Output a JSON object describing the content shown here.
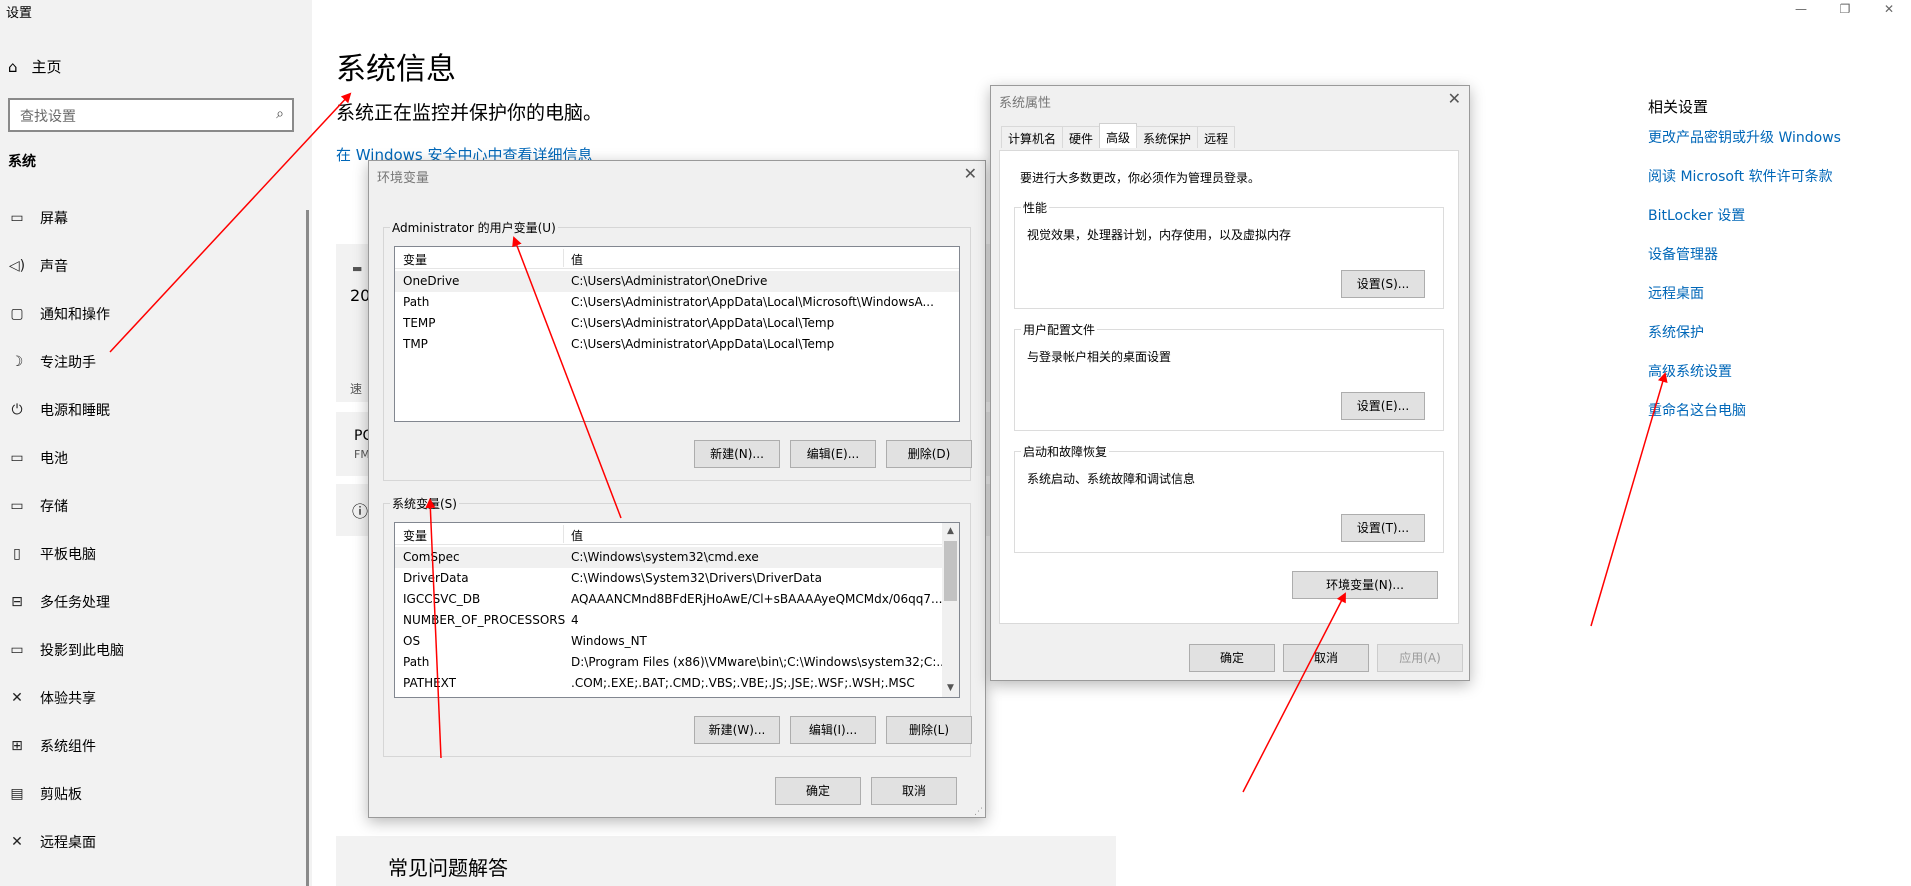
{
  "settings": {
    "window_title": "设置",
    "home_label": "主页",
    "search_placeholder": "查找设置",
    "section_label": "系统",
    "nav_items": [
      {
        "label": "屏幕",
        "icon": "display-icon"
      },
      {
        "label": "声音",
        "icon": "speaker-icon"
      },
      {
        "label": "通知和操作",
        "icon": "notification-icon"
      },
      {
        "label": "专注助手",
        "icon": "moon-icon"
      },
      {
        "label": "电源和睡眠",
        "icon": "power-icon"
      },
      {
        "label": "电池",
        "icon": "battery-icon"
      },
      {
        "label": "存储",
        "icon": "storage-icon"
      },
      {
        "label": "平板电脑",
        "icon": "tablet-icon"
      },
      {
        "label": "多任务处理",
        "icon": "multitask-icon"
      },
      {
        "label": "投影到此电脑",
        "icon": "project-icon"
      },
      {
        "label": "体验共享",
        "icon": "share-icon"
      },
      {
        "label": "系统组件",
        "icon": "components-icon"
      },
      {
        "label": "剪贴板",
        "icon": "clipboard-icon"
      },
      {
        "label": "远程桌面",
        "icon": "remote-icon"
      }
    ]
  },
  "main": {
    "title": "系统信息",
    "subtitle": "系统正在监控并保护你的电脑。",
    "security_link": "在 Windows 安全中心中查看详细信息",
    "card_fragments": [
      "20",
      "速",
      "PC",
      "FM"
    ],
    "faq_heading": "常见问题解答"
  },
  "related": {
    "title": "相关设置",
    "links": [
      "更改产品密钥或升级 Windows",
      "阅读 Microsoft 软件许可条款",
      "BitLocker 设置",
      "设备管理器",
      "远程桌面",
      "系统保护",
      "高级系统设置",
      "重命名这台电脑"
    ]
  },
  "env_dialog": {
    "title": "环境变量",
    "user_group": "Administrator 的用户变量(U)",
    "col_var": "变量",
    "col_val": "值",
    "user_vars": [
      {
        "name": "OneDrive",
        "value": "C:\\Users\\Administrator\\OneDrive"
      },
      {
        "name": "Path",
        "value": "C:\\Users\\Administrator\\AppData\\Local\\Microsoft\\WindowsA..."
      },
      {
        "name": "TEMP",
        "value": "C:\\Users\\Administrator\\AppData\\Local\\Temp"
      },
      {
        "name": "TMP",
        "value": "C:\\Users\\Administrator\\AppData\\Local\\Temp"
      }
    ],
    "user_buttons": [
      "新建(N)...",
      "编辑(E)...",
      "删除(D)"
    ],
    "system_group": "系统变量(S)",
    "system_vars": [
      {
        "name": "ComSpec",
        "value": "C:\\Windows\\system32\\cmd.exe"
      },
      {
        "name": "DriverData",
        "value": "C:\\Windows\\System32\\Drivers\\DriverData"
      },
      {
        "name": "IGCCSVC_DB",
        "value": "AQAAANCMnd8BFdERjHoAwE/Cl+sBAAAAyeQMCMdx/06qq7..."
      },
      {
        "name": "NUMBER_OF_PROCESSORS",
        "value": "4"
      },
      {
        "name": "OS",
        "value": "Windows_NT"
      },
      {
        "name": "Path",
        "value": "D:\\Program Files (x86)\\VMware\\bin\\;C:\\Windows\\system32;C:..."
      },
      {
        "name": "PATHEXT",
        "value": ".COM;.EXE;.BAT;.CMD;.VBS;.VBE;.JS;.JSE;.WSF;.WSH;.MSC"
      }
    ],
    "system_buttons": [
      "新建(W)...",
      "编辑(I)...",
      "删除(L)"
    ],
    "ok": "确定",
    "cancel": "取消"
  },
  "sys_dialog": {
    "title": "系统属性",
    "tabs": [
      "计算机名",
      "硬件",
      "高级",
      "系统保护",
      "远程"
    ],
    "admin_note": "要进行大多数更改，你必须作为管理员登录。",
    "perf_label": "性能",
    "perf_desc": "视觉效果，处理器计划，内存使用，以及虚拟内存",
    "perf_btn": "设置(S)...",
    "profile_label": "用户配置文件",
    "profile_desc": "与登录帐户相关的桌面设置",
    "profile_btn": "设置(E)...",
    "startup_label": "启动和故障恢复",
    "startup_desc": "系统启动、系统故障和调试信息",
    "startup_btn": "设置(T)...",
    "env_btn": "环境变量(N)...",
    "ok": "确定",
    "cancel": "取消",
    "apply": "应用(A)"
  },
  "colors": {
    "link": "#0067b8",
    "arrow": "#ff0000",
    "sidebar_bg": "#f2f2f2",
    "dialog_bg": "#f0f0f0"
  }
}
